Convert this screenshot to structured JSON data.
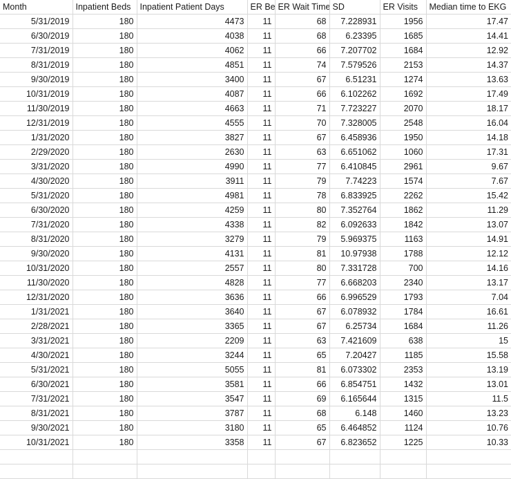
{
  "sheet": {
    "columns": [
      {
        "key": "month",
        "label": "Month",
        "name": "column-header-month"
      },
      {
        "key": "ipbeds",
        "label": "Inpatient Beds",
        "name": "column-header-inpatient-beds"
      },
      {
        "key": "ipdays",
        "label": "Inpatient Patient Days",
        "name": "column-header-inpatient-patient-days"
      },
      {
        "key": "erbeds",
        "label": "ER Beds",
        "name": "column-header-er-beds"
      },
      {
        "key": "erwait",
        "label": "ER Wait Time",
        "name": "column-header-er-wait-time"
      },
      {
        "key": "sd",
        "label": "SD",
        "name": "column-header-sd"
      },
      {
        "key": "ervisits",
        "label": "ER Visits",
        "name": "column-header-er-visits"
      },
      {
        "key": "ekg",
        "label": "Median time to EKG",
        "name": "column-header-median-time-to-ekg"
      }
    ],
    "rows": [
      {
        "month": "5/31/2019",
        "ipbeds": "180",
        "ipdays": "4473",
        "erbeds": "11",
        "erwait": "68",
        "sd": "7.228931",
        "ervisits": "1956",
        "ekg": "17.47"
      },
      {
        "month": "6/30/2019",
        "ipbeds": "180",
        "ipdays": "4038",
        "erbeds": "11",
        "erwait": "68",
        "sd": "6.23395",
        "ervisits": "1685",
        "ekg": "14.41"
      },
      {
        "month": "7/31/2019",
        "ipbeds": "180",
        "ipdays": "4062",
        "erbeds": "11",
        "erwait": "66",
        "sd": "7.207702",
        "ervisits": "1684",
        "ekg": "12.92"
      },
      {
        "month": "8/31/2019",
        "ipbeds": "180",
        "ipdays": "4851",
        "erbeds": "11",
        "erwait": "74",
        "sd": "7.579526",
        "ervisits": "2153",
        "ekg": "14.37"
      },
      {
        "month": "9/30/2019",
        "ipbeds": "180",
        "ipdays": "3400",
        "erbeds": "11",
        "erwait": "67",
        "sd": "6.51231",
        "ervisits": "1274",
        "ekg": "13.63"
      },
      {
        "month": "10/31/2019",
        "ipbeds": "180",
        "ipdays": "4087",
        "erbeds": "11",
        "erwait": "66",
        "sd": "6.102262",
        "ervisits": "1692",
        "ekg": "17.49"
      },
      {
        "month": "11/30/2019",
        "ipbeds": "180",
        "ipdays": "4663",
        "erbeds": "11",
        "erwait": "71",
        "sd": "7.723227",
        "ervisits": "2070",
        "ekg": "18.17"
      },
      {
        "month": "12/31/2019",
        "ipbeds": "180",
        "ipdays": "4555",
        "erbeds": "11",
        "erwait": "70",
        "sd": "7.328005",
        "ervisits": "2548",
        "ekg": "16.04"
      },
      {
        "month": "1/31/2020",
        "ipbeds": "180",
        "ipdays": "3827",
        "erbeds": "11",
        "erwait": "67",
        "sd": "6.458936",
        "ervisits": "1950",
        "ekg": "14.18"
      },
      {
        "month": "2/29/2020",
        "ipbeds": "180",
        "ipdays": "2630",
        "erbeds": "11",
        "erwait": "63",
        "sd": "6.651062",
        "ervisits": "1060",
        "ekg": "17.31"
      },
      {
        "month": "3/31/2020",
        "ipbeds": "180",
        "ipdays": "4990",
        "erbeds": "11",
        "erwait": "77",
        "sd": "6.410845",
        "ervisits": "2961",
        "ekg": "9.67"
      },
      {
        "month": "4/30/2020",
        "ipbeds": "180",
        "ipdays": "3911",
        "erbeds": "11",
        "erwait": "79",
        "sd": "7.74223",
        "ervisits": "1574",
        "ekg": "7.67"
      },
      {
        "month": "5/31/2020",
        "ipbeds": "180",
        "ipdays": "4981",
        "erbeds": "11",
        "erwait": "78",
        "sd": "6.833925",
        "ervisits": "2262",
        "ekg": "15.42"
      },
      {
        "month": "6/30/2020",
        "ipbeds": "180",
        "ipdays": "4259",
        "erbeds": "11",
        "erwait": "80",
        "sd": "7.352764",
        "ervisits": "1862",
        "ekg": "11.29"
      },
      {
        "month": "7/31/2020",
        "ipbeds": "180",
        "ipdays": "4338",
        "erbeds": "11",
        "erwait": "82",
        "sd": "6.092633",
        "ervisits": "1842",
        "ekg": "13.07"
      },
      {
        "month": "8/31/2020",
        "ipbeds": "180",
        "ipdays": "3279",
        "erbeds": "11",
        "erwait": "79",
        "sd": "5.969375",
        "ervisits": "1163",
        "ekg": "14.91"
      },
      {
        "month": "9/30/2020",
        "ipbeds": "180",
        "ipdays": "4131",
        "erbeds": "11",
        "erwait": "81",
        "sd": "10.97938",
        "ervisits": "1788",
        "ekg": "12.12"
      },
      {
        "month": "10/31/2020",
        "ipbeds": "180",
        "ipdays": "2557",
        "erbeds": "11",
        "erwait": "80",
        "sd": "7.331728",
        "ervisits": "700",
        "ekg": "14.16"
      },
      {
        "month": "11/30/2020",
        "ipbeds": "180",
        "ipdays": "4828",
        "erbeds": "11",
        "erwait": "77",
        "sd": "6.668203",
        "ervisits": "2340",
        "ekg": "13.17"
      },
      {
        "month": "12/31/2020",
        "ipbeds": "180",
        "ipdays": "3636",
        "erbeds": "11",
        "erwait": "66",
        "sd": "6.996529",
        "ervisits": "1793",
        "ekg": "7.04"
      },
      {
        "month": "1/31/2021",
        "ipbeds": "180",
        "ipdays": "3640",
        "erbeds": "11",
        "erwait": "67",
        "sd": "6.078932",
        "ervisits": "1784",
        "ekg": "16.61"
      },
      {
        "month": "2/28/2021",
        "ipbeds": "180",
        "ipdays": "3365",
        "erbeds": "11",
        "erwait": "67",
        "sd": "6.25734",
        "ervisits": "1684",
        "ekg": "11.26"
      },
      {
        "month": "3/31/2021",
        "ipbeds": "180",
        "ipdays": "2209",
        "erbeds": "11",
        "erwait": "63",
        "sd": "7.421609",
        "ervisits": "638",
        "ekg": "15"
      },
      {
        "month": "4/30/2021",
        "ipbeds": "180",
        "ipdays": "3244",
        "erbeds": "11",
        "erwait": "65",
        "sd": "7.20427",
        "ervisits": "1185",
        "ekg": "15.58"
      },
      {
        "month": "5/31/2021",
        "ipbeds": "180",
        "ipdays": "5055",
        "erbeds": "11",
        "erwait": "81",
        "sd": "6.073302",
        "ervisits": "2353",
        "ekg": "13.19"
      },
      {
        "month": "6/30/2021",
        "ipbeds": "180",
        "ipdays": "3581",
        "erbeds": "11",
        "erwait": "66",
        "sd": "6.854751",
        "ervisits": "1432",
        "ekg": "13.01"
      },
      {
        "month": "7/31/2021",
        "ipbeds": "180",
        "ipdays": "3547",
        "erbeds": "11",
        "erwait": "69",
        "sd": "6.165644",
        "ervisits": "1315",
        "ekg": "11.5"
      },
      {
        "month": "8/31/2021",
        "ipbeds": "180",
        "ipdays": "3787",
        "erbeds": "11",
        "erwait": "68",
        "sd": "6.148",
        "ervisits": "1460",
        "ekg": "13.23"
      },
      {
        "month": "9/30/2021",
        "ipbeds": "180",
        "ipdays": "3180",
        "erbeds": "11",
        "erwait": "65",
        "sd": "6.464852",
        "ervisits": "1124",
        "ekg": "10.76"
      },
      {
        "month": "10/31/2021",
        "ipbeds": "180",
        "ipdays": "3358",
        "erbeds": "11",
        "erwait": "67",
        "sd": "6.823652",
        "ervisits": "1225",
        "ekg": "10.33"
      }
    ],
    "empty_row_count": 2,
    "colors": {
      "background": "#ffffff",
      "gridline": "#d9d9d9",
      "text": "#1a1a1a"
    }
  },
  "chart_data": {
    "type": "table",
    "title": "",
    "categories": [
      "5/31/2019",
      "6/30/2019",
      "7/31/2019",
      "8/31/2019",
      "9/30/2019",
      "10/31/2019",
      "11/30/2019",
      "12/31/2019",
      "1/31/2020",
      "2/29/2020",
      "3/31/2020",
      "4/30/2020",
      "5/31/2020",
      "6/30/2020",
      "7/31/2020",
      "8/31/2020",
      "9/30/2020",
      "10/31/2020",
      "11/30/2020",
      "12/31/2020",
      "1/31/2021",
      "2/28/2021",
      "3/31/2021",
      "4/30/2021",
      "5/31/2021",
      "6/30/2021",
      "7/31/2021",
      "8/31/2021",
      "9/30/2021",
      "10/31/2021"
    ],
    "series": [
      {
        "name": "Inpatient Beds",
        "values": [
          180,
          180,
          180,
          180,
          180,
          180,
          180,
          180,
          180,
          180,
          180,
          180,
          180,
          180,
          180,
          180,
          180,
          180,
          180,
          180,
          180,
          180,
          180,
          180,
          180,
          180,
          180,
          180,
          180,
          180
        ]
      },
      {
        "name": "Inpatient Patient Days",
        "values": [
          4473,
          4038,
          4062,
          4851,
          3400,
          4087,
          4663,
          4555,
          3827,
          2630,
          4990,
          3911,
          4981,
          4259,
          4338,
          3279,
          4131,
          2557,
          4828,
          3636,
          3640,
          3365,
          2209,
          3244,
          5055,
          3581,
          3547,
          3787,
          3180,
          3358
        ]
      },
      {
        "name": "ER Beds",
        "values": [
          11,
          11,
          11,
          11,
          11,
          11,
          11,
          11,
          11,
          11,
          11,
          11,
          11,
          11,
          11,
          11,
          11,
          11,
          11,
          11,
          11,
          11,
          11,
          11,
          11,
          11,
          11,
          11,
          11,
          11
        ]
      },
      {
        "name": "ER Wait Time",
        "values": [
          68,
          68,
          66,
          74,
          67,
          66,
          71,
          70,
          67,
          63,
          77,
          79,
          78,
          80,
          82,
          79,
          81,
          80,
          77,
          66,
          67,
          67,
          63,
          65,
          81,
          66,
          69,
          68,
          65,
          67
        ]
      },
      {
        "name": "SD",
        "values": [
          7.228931,
          6.23395,
          7.207702,
          7.579526,
          6.51231,
          6.102262,
          7.723227,
          7.328005,
          6.458936,
          6.651062,
          6.410845,
          7.74223,
          6.833925,
          7.352764,
          6.092633,
          5.969375,
          10.97938,
          7.331728,
          6.668203,
          6.996529,
          6.078932,
          6.25734,
          7.421609,
          7.20427,
          6.073302,
          6.854751,
          6.165644,
          6.148,
          6.464852,
          6.823652
        ]
      },
      {
        "name": "ER Visits",
        "values": [
          1956,
          1685,
          1684,
          2153,
          1274,
          1692,
          2070,
          2548,
          1950,
          1060,
          2961,
          1574,
          2262,
          1862,
          1842,
          1163,
          1788,
          700,
          2340,
          1793,
          1784,
          1684,
          638,
          1185,
          2353,
          1432,
          1315,
          1460,
          1124,
          1225
        ]
      },
      {
        "name": "Median time to EKG",
        "values": [
          17.47,
          14.41,
          12.92,
          14.37,
          13.63,
          17.49,
          18.17,
          16.04,
          14.18,
          17.31,
          9.67,
          7.67,
          15.42,
          11.29,
          13.07,
          14.91,
          12.12,
          14.16,
          13.17,
          7.04,
          16.61,
          11.26,
          15,
          15.58,
          13.19,
          13.01,
          11.5,
          13.23,
          10.76,
          10.33
        ]
      }
    ],
    "xlabel": "Month",
    "ylabel": ""
  }
}
